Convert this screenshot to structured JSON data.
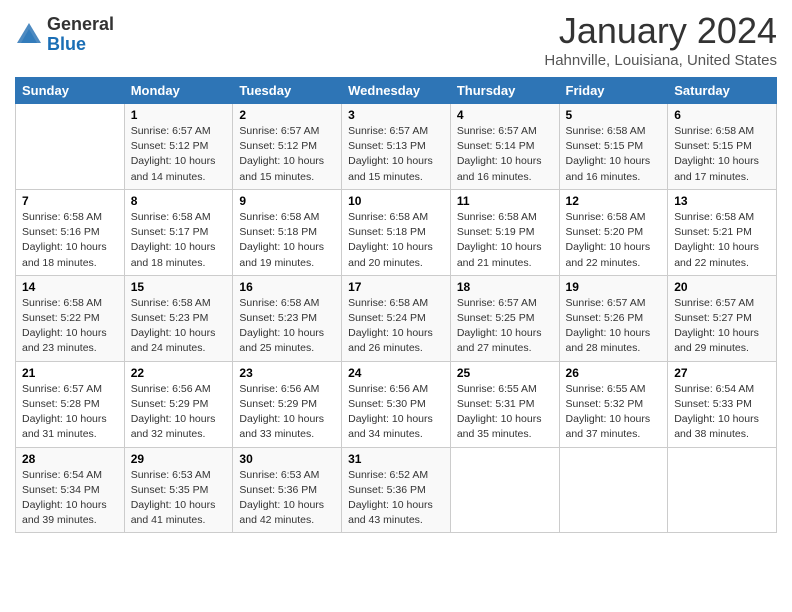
{
  "header": {
    "logo_general": "General",
    "logo_blue": "Blue",
    "title": "January 2024",
    "subtitle": "Hahnville, Louisiana, United States"
  },
  "calendar": {
    "days_of_week": [
      "Sunday",
      "Monday",
      "Tuesday",
      "Wednesday",
      "Thursday",
      "Friday",
      "Saturday"
    ],
    "weeks": [
      [
        {
          "day": "",
          "info": ""
        },
        {
          "day": "1",
          "info": "Sunrise: 6:57 AM\nSunset: 5:12 PM\nDaylight: 10 hours\nand 14 minutes."
        },
        {
          "day": "2",
          "info": "Sunrise: 6:57 AM\nSunset: 5:12 PM\nDaylight: 10 hours\nand 15 minutes."
        },
        {
          "day": "3",
          "info": "Sunrise: 6:57 AM\nSunset: 5:13 PM\nDaylight: 10 hours\nand 15 minutes."
        },
        {
          "day": "4",
          "info": "Sunrise: 6:57 AM\nSunset: 5:14 PM\nDaylight: 10 hours\nand 16 minutes."
        },
        {
          "day": "5",
          "info": "Sunrise: 6:58 AM\nSunset: 5:15 PM\nDaylight: 10 hours\nand 16 minutes."
        },
        {
          "day": "6",
          "info": "Sunrise: 6:58 AM\nSunset: 5:15 PM\nDaylight: 10 hours\nand 17 minutes."
        }
      ],
      [
        {
          "day": "7",
          "info": "Sunrise: 6:58 AM\nSunset: 5:16 PM\nDaylight: 10 hours\nand 18 minutes."
        },
        {
          "day": "8",
          "info": "Sunrise: 6:58 AM\nSunset: 5:17 PM\nDaylight: 10 hours\nand 18 minutes."
        },
        {
          "day": "9",
          "info": "Sunrise: 6:58 AM\nSunset: 5:18 PM\nDaylight: 10 hours\nand 19 minutes."
        },
        {
          "day": "10",
          "info": "Sunrise: 6:58 AM\nSunset: 5:18 PM\nDaylight: 10 hours\nand 20 minutes."
        },
        {
          "day": "11",
          "info": "Sunrise: 6:58 AM\nSunset: 5:19 PM\nDaylight: 10 hours\nand 21 minutes."
        },
        {
          "day": "12",
          "info": "Sunrise: 6:58 AM\nSunset: 5:20 PM\nDaylight: 10 hours\nand 22 minutes."
        },
        {
          "day": "13",
          "info": "Sunrise: 6:58 AM\nSunset: 5:21 PM\nDaylight: 10 hours\nand 22 minutes."
        }
      ],
      [
        {
          "day": "14",
          "info": "Sunrise: 6:58 AM\nSunset: 5:22 PM\nDaylight: 10 hours\nand 23 minutes."
        },
        {
          "day": "15",
          "info": "Sunrise: 6:58 AM\nSunset: 5:23 PM\nDaylight: 10 hours\nand 24 minutes."
        },
        {
          "day": "16",
          "info": "Sunrise: 6:58 AM\nSunset: 5:23 PM\nDaylight: 10 hours\nand 25 minutes."
        },
        {
          "day": "17",
          "info": "Sunrise: 6:58 AM\nSunset: 5:24 PM\nDaylight: 10 hours\nand 26 minutes."
        },
        {
          "day": "18",
          "info": "Sunrise: 6:57 AM\nSunset: 5:25 PM\nDaylight: 10 hours\nand 27 minutes."
        },
        {
          "day": "19",
          "info": "Sunrise: 6:57 AM\nSunset: 5:26 PM\nDaylight: 10 hours\nand 28 minutes."
        },
        {
          "day": "20",
          "info": "Sunrise: 6:57 AM\nSunset: 5:27 PM\nDaylight: 10 hours\nand 29 minutes."
        }
      ],
      [
        {
          "day": "21",
          "info": "Sunrise: 6:57 AM\nSunset: 5:28 PM\nDaylight: 10 hours\nand 31 minutes."
        },
        {
          "day": "22",
          "info": "Sunrise: 6:56 AM\nSunset: 5:29 PM\nDaylight: 10 hours\nand 32 minutes."
        },
        {
          "day": "23",
          "info": "Sunrise: 6:56 AM\nSunset: 5:29 PM\nDaylight: 10 hours\nand 33 minutes."
        },
        {
          "day": "24",
          "info": "Sunrise: 6:56 AM\nSunset: 5:30 PM\nDaylight: 10 hours\nand 34 minutes."
        },
        {
          "day": "25",
          "info": "Sunrise: 6:55 AM\nSunset: 5:31 PM\nDaylight: 10 hours\nand 35 minutes."
        },
        {
          "day": "26",
          "info": "Sunrise: 6:55 AM\nSunset: 5:32 PM\nDaylight: 10 hours\nand 37 minutes."
        },
        {
          "day": "27",
          "info": "Sunrise: 6:54 AM\nSunset: 5:33 PM\nDaylight: 10 hours\nand 38 minutes."
        }
      ],
      [
        {
          "day": "28",
          "info": "Sunrise: 6:54 AM\nSunset: 5:34 PM\nDaylight: 10 hours\nand 39 minutes."
        },
        {
          "day": "29",
          "info": "Sunrise: 6:53 AM\nSunset: 5:35 PM\nDaylight: 10 hours\nand 41 minutes."
        },
        {
          "day": "30",
          "info": "Sunrise: 6:53 AM\nSunset: 5:36 PM\nDaylight: 10 hours\nand 42 minutes."
        },
        {
          "day": "31",
          "info": "Sunrise: 6:52 AM\nSunset: 5:36 PM\nDaylight: 10 hours\nand 43 minutes."
        },
        {
          "day": "",
          "info": ""
        },
        {
          "day": "",
          "info": ""
        },
        {
          "day": "",
          "info": ""
        }
      ]
    ]
  }
}
